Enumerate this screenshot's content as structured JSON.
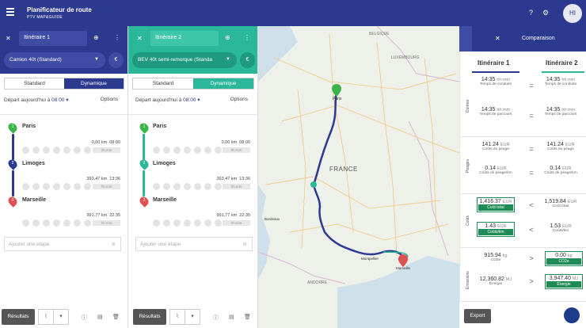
{
  "app": {
    "title": "Planificateur de route",
    "subtitle": "PTV MAP&GUIDE",
    "avatar": "HI"
  },
  "colors": {
    "primary": "#2b3a8f",
    "route2": "#2bb89a",
    "highlight": "#1f8b56"
  },
  "routes": [
    {
      "name": "Itinéraire 1",
      "vehicle": "Camion 40t (Standard)",
      "tabs": [
        "Standard",
        "Dynamique"
      ],
      "active_tab": "Dynamique",
      "departure_label": "Départ aujourd'hui à",
      "departure_time": "08:00",
      "options_label": "Options",
      "stops": [
        {
          "num": "1",
          "name": "Paris",
          "dist": "0,00 km",
          "time": "08:00",
          "dur": "hh:mm"
        },
        {
          "num": "2",
          "name": "Limoges",
          "dist": "393,47 km",
          "time": "13:36",
          "dur": "hh:mm"
        },
        {
          "num": "3",
          "name": "Marseille",
          "dist": "991,77 km",
          "time": "22:35",
          "dur": "hh:mm"
        }
      ],
      "add_stop": "Ajouter une étape",
      "results_label": "Résultats"
    },
    {
      "name": "Itinéraire 2",
      "vehicle": "BEV 40t semi-remorque (Standa",
      "tabs": [
        "Standard",
        "Dynamique"
      ],
      "active_tab": "Dynamique",
      "departure_label": "Départ aujourd'hui à",
      "departure_time": "08:00",
      "options_label": "Options",
      "stops": [
        {
          "num": "1",
          "name": "Paris",
          "dist": "0,00 km",
          "time": "08:00",
          "dur": "hh:mm"
        },
        {
          "num": "2",
          "name": "Limoges",
          "dist": "393,47 km",
          "time": "13:36",
          "dur": "hh:mm"
        },
        {
          "num": "3",
          "name": "Marseille",
          "dist": "991,77 km",
          "time": "22:35",
          "dur": "hh:mm"
        }
      ],
      "add_stop": "Ajouter une étape",
      "results_label": "Résultats"
    }
  ],
  "map": {
    "labels": {
      "country": "FRANCE",
      "belgique": "BELGIQUE",
      "luxembourg": "LUXEMBOURG",
      "andorre": "ANDORRE",
      "paris": "Paris",
      "montpellier": "Montpellier",
      "marseille": "Marseille",
      "bordeaux": "Bordeaux"
    }
  },
  "comparison": {
    "title": "Comparaison",
    "col1": "Itinéraire 1",
    "col2": "Itinéraire 2",
    "sections": {
      "durees": "Durées",
      "peages": "Péages",
      "couts": "Coûts",
      "emissions": "Émissions"
    },
    "rows": [
      {
        "a_val": "14:35",
        "a_unit": "hh:mm",
        "op": "=",
        "b_val": "14:35",
        "b_unit": "hh:mm",
        "label": "Temps de conduite"
      },
      {
        "a_val": "14:35",
        "a_unit": "hh:mm",
        "op": "=",
        "b_val": "14:35",
        "b_unit": "hh:mm",
        "label": "Temps de parcours"
      },
      {
        "a_val": "141.24",
        "a_unit": "EUR",
        "op": "=",
        "b_val": "141.24",
        "b_unit": "EUR",
        "label": "Coûts du péage"
      },
      {
        "a_val": "0.14",
        "a_unit": "EUR",
        "op": "=",
        "b_val": "0.14",
        "b_unit": "EUR",
        "label": "Coûts de péage/km"
      },
      {
        "a_val": "1,416.37",
        "a_unit": "EUR",
        "op": "<",
        "b_val": "1,519.84",
        "b_unit": "EUR",
        "label": "Coût total"
      },
      {
        "a_val": "1.43",
        "a_unit": "EUR",
        "op": "<",
        "b_val": "1.53",
        "b_unit": "EUR",
        "label": "Coûts/km"
      },
      {
        "a_val": "915.94",
        "a_unit": "kg",
        "op": ">",
        "b_val": "0.00",
        "b_unit": "kg",
        "label": "CO2e"
      },
      {
        "a_val": "12,360.82",
        "a_unit": "MJ",
        "op": ">",
        "b_val": "3,947.40",
        "b_unit": "MJ",
        "label": "Énergie"
      }
    ],
    "export_label": "Export"
  }
}
